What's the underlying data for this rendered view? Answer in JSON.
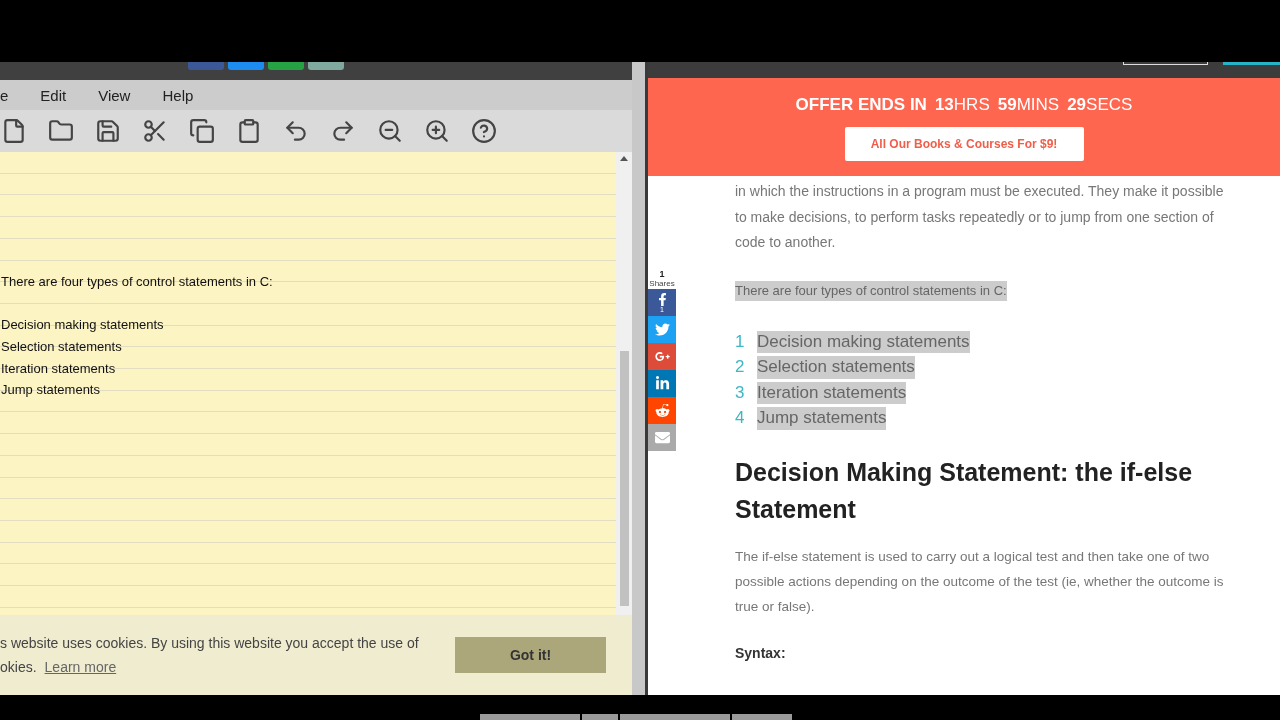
{
  "editor": {
    "menu": [
      "e",
      "Edit",
      "View",
      "Help"
    ],
    "blocks": [
      {
        "lines": [
          "There are four types of control statements in C:"
        ]
      },
      {
        "lines": [
          "Decision making statements",
          "Selection statements",
          "Iteration statements",
          "Jump statements"
        ]
      }
    ],
    "cookie": {
      "line_1": "s website uses cookies. By using this website you accept the use of",
      "line_2": "okies.",
      "link": "Learn more",
      "button": "Got it!"
    }
  },
  "article": {
    "banner": {
      "label": "OFFER ENDS IN",
      "units": [
        "**13**HRS",
        "**59**MINS",
        "**29**SECS"
      ],
      "button": "All Our Books & Courses For $9!"
    },
    "share": {
      "count": "1",
      "label": "Shares",
      "buttons": [
        {
          "kind": "facebook",
          "count": "1"
        },
        {
          "kind": "twitter"
        },
        {
          "kind": "googleplus"
        },
        {
          "kind": "linkedin"
        },
        {
          "kind": "reddit"
        },
        {
          "kind": "email"
        }
      ]
    },
    "intro": "in which the instructions in a program must be executed. They make it possible to make decisions, to perform tasks repeatedly or to jump from one section of code to another.",
    "lead": "There are four types of control statements in C:",
    "list": [
      {
        "number": "1",
        "text": "Decision making statements"
      },
      {
        "number": "2",
        "text": "Selection statements"
      },
      {
        "number": "3",
        "text": "Iteration statements"
      },
      {
        "number": "4",
        "text": "Jump statements"
      }
    ],
    "heading": "Decision Making Statement: the if-else Statement",
    "body": "The if-else statement is used to carry out a logical test and then take one of two possible actions depending on the outcome of the test (ie, whether the outcome is true or false).",
    "syntax": "Syntax:"
  }
}
